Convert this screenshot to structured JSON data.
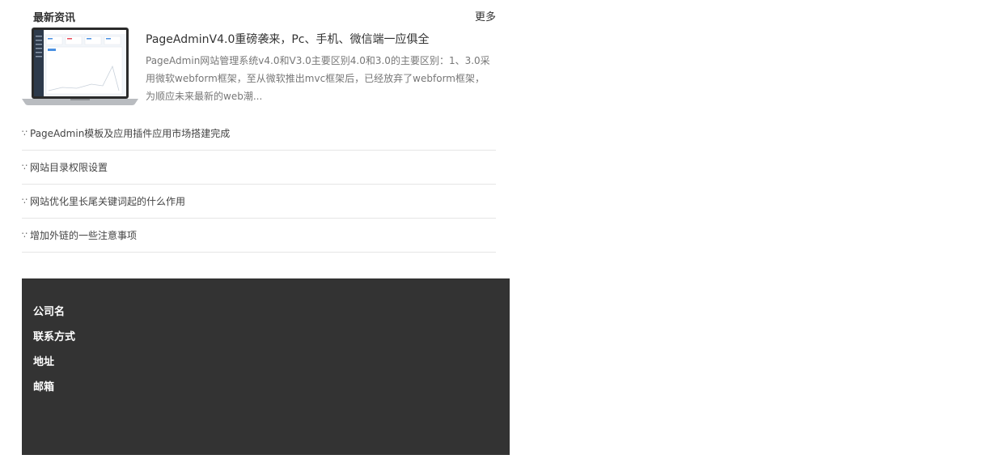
{
  "news": {
    "title": "最新资讯",
    "more_label": "更多",
    "featured": {
      "title": "PageAdminV4.0重磅袭来，Pc、手机、微信端一应俱全",
      "summary": "PageAdmin网站管理系统v4.0和V3.0主要区别4.0和3.0的主要区别：1、3.0采用微软webform框架，至从微软推出mvc框架后，已经放弃了webform框架，为顺应未来最新的web潮..."
    },
    "bullet": "∵",
    "items": [
      {
        "label": "PageAdmin模板及应用插件应用市场搭建完成"
      },
      {
        "label": "网站目录权限设置"
      },
      {
        "label": "网站优化里长尾关键词起的什么作用"
      },
      {
        "label": "增加外链的一些注意事项"
      }
    ]
  },
  "footer": {
    "company": "公司名",
    "contact": "联系方式",
    "address": "地址",
    "email": "邮箱"
  }
}
